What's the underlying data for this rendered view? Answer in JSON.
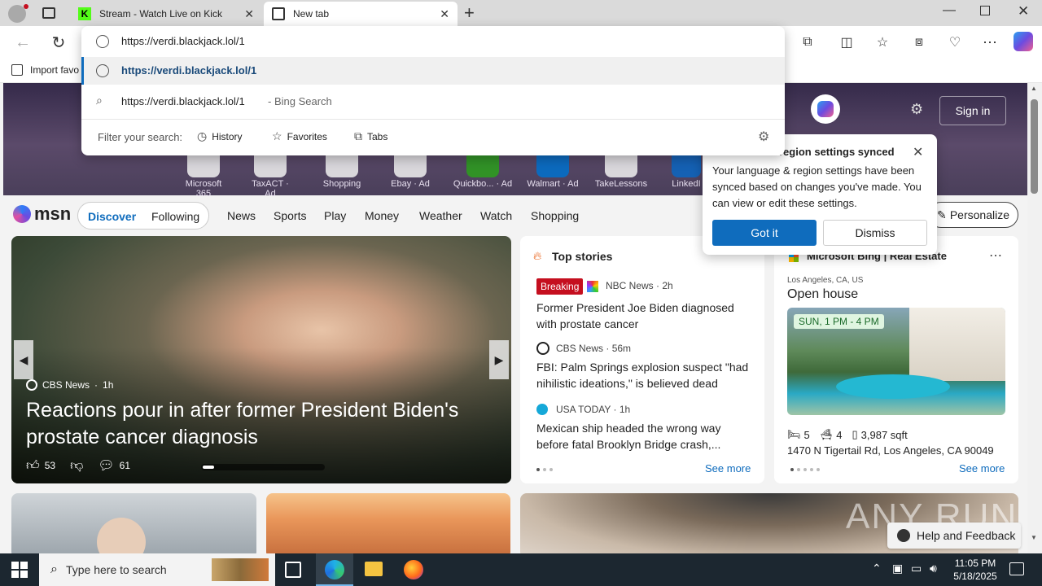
{
  "tabs": [
    {
      "title": "Stream - Watch Live on Kick",
      "active": false
    },
    {
      "title": "New tab",
      "active": true
    }
  ],
  "omnibox": {
    "value": "https://verdi.blackjack.lol/1",
    "suggestion_url": "https://verdi.blackjack.lol/1",
    "search_query": "https://verdi.blackjack.lol/1",
    "search_suffix": "- Bing Search",
    "filter_label": "Filter your search:",
    "filters": [
      "History",
      "Favorites",
      "Tabs"
    ]
  },
  "favbar": {
    "import": "Import favo"
  },
  "hero": {
    "signin": "Sign in",
    "quick_links": [
      {
        "label": "Microsoft 365"
      },
      {
        "label": "TaxACT",
        "ad": "Ad"
      },
      {
        "label": "Shopping"
      },
      {
        "label": "Ebay",
        "ad": "Ad"
      },
      {
        "label": "Quickbo...",
        "ad": "Ad"
      },
      {
        "label": "Walmart",
        "ad": "Ad"
      },
      {
        "label": "TakeLessons"
      },
      {
        "label": "LinkedI"
      }
    ]
  },
  "popup": {
    "title": "region settings synced",
    "body": "Your language & region settings have been synced based on changes you've made. You can view or edit these settings.",
    "primary": "Got it",
    "secondary": "Dismiss"
  },
  "nav": {
    "logo": "msn",
    "discover": "Discover",
    "following": "Following",
    "items": [
      "News",
      "Sports",
      "Play",
      "Money",
      "Weather",
      "Watch",
      "Shopping"
    ],
    "personalize": "Personalize"
  },
  "lead": {
    "source": "CBS News",
    "age": "1h",
    "headline": "Reactions pour in after former President Biden's prostate cancer diagnosis",
    "likes": "53",
    "comments": "61"
  },
  "top_stories": {
    "title": "Top stories",
    "items": [
      {
        "badge": "Breaking",
        "source": "NBC News",
        "age": "2h",
        "headline": "Former President Joe Biden diagnosed with prostate cancer"
      },
      {
        "badge": "",
        "source": "CBS News",
        "age": "56m",
        "headline": "FBI: Palm Springs explosion suspect \"had nihilistic ideations,\" is believed dead"
      },
      {
        "badge": "",
        "source": "USA TODAY",
        "age": "1h",
        "headline": "Mexican ship headed the wrong way before fatal Brooklyn Bridge crash,..."
      }
    ],
    "see_more": "See more"
  },
  "realestate": {
    "provider": "Microsoft Bing | Real Estate",
    "location": "Los Angeles, CA, US",
    "title": "Open house",
    "tag": "SUN, 1 PM - 4 PM",
    "beds": "5",
    "baths": "4",
    "sqft": "3,987 sqft",
    "address": "1470 N Tigertail Rd, Los Angeles, CA 90049",
    "see_more": "See more"
  },
  "feedback": "Help and Feedback",
  "watermark": "ANY RUN",
  "taskbar": {
    "search_placeholder": "Type here to search",
    "time": "11:05 PM",
    "date": "5/18/2025"
  },
  "colors": {
    "accent": "#0f6cbd",
    "primary_btn": "#0f6cbd",
    "breaking": "#c50f1f",
    "kick": "#53fc18"
  }
}
